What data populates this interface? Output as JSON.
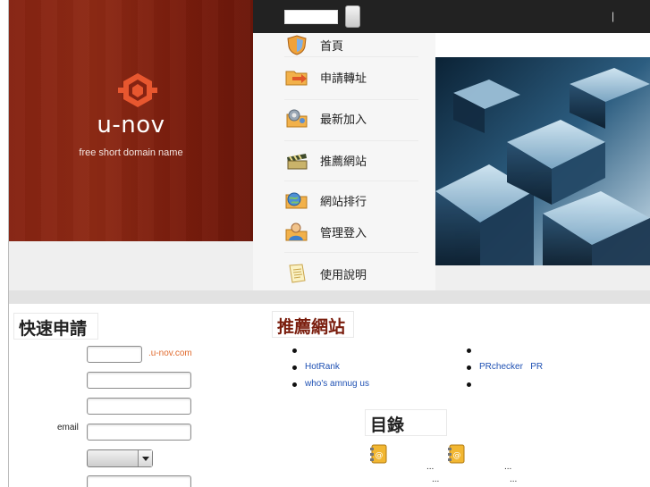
{
  "brand": {
    "name": "u-nov",
    "tagline": "free short domain name"
  },
  "topbar": {
    "search_value": "",
    "separator": "|"
  },
  "menu": [
    {
      "label": "首頁",
      "icon": "shield-icon"
    },
    {
      "label": "申請轉址",
      "icon": "folder-arrow-icon"
    },
    {
      "label": "最新加入",
      "icon": "gear-icon"
    },
    {
      "label": "推薦網站",
      "icon": "clapperboard-icon"
    },
    {
      "label": "網站排行",
      "icon": "folder-globe-icon"
    },
    {
      "label": "管理登入",
      "icon": "user-icon"
    },
    {
      "label": "使用說明",
      "icon": "document-icon"
    }
  ],
  "quick_apply": {
    "heading": "快速申請",
    "domain_suffix": ".u-nov.com",
    "email_label": "email",
    "fields": {
      "subdomain_value": "",
      "url_value": "",
      "title_value": "",
      "email_value": "",
      "category_value": "",
      "extra_value": ""
    }
  },
  "recommended": {
    "heading": "推薦網站",
    "left_items": [
      "",
      "HotRank",
      "who's amnug us"
    ],
    "right_items": [
      "",
      "PRchecker   PR",
      ""
    ]
  },
  "directory": {
    "heading": "目錄",
    "entries": [
      {
        "icon": "address-book-icon",
        "lines": [
          "...",
          "..."
        ]
      },
      {
        "icon": "address-book-icon",
        "lines": [
          "...",
          "..."
        ]
      }
    ]
  },
  "colors": {
    "brand_red": "#862312",
    "topbar": "#222222",
    "link": "#1e50b3",
    "suffix_orange": "#e0692c"
  }
}
